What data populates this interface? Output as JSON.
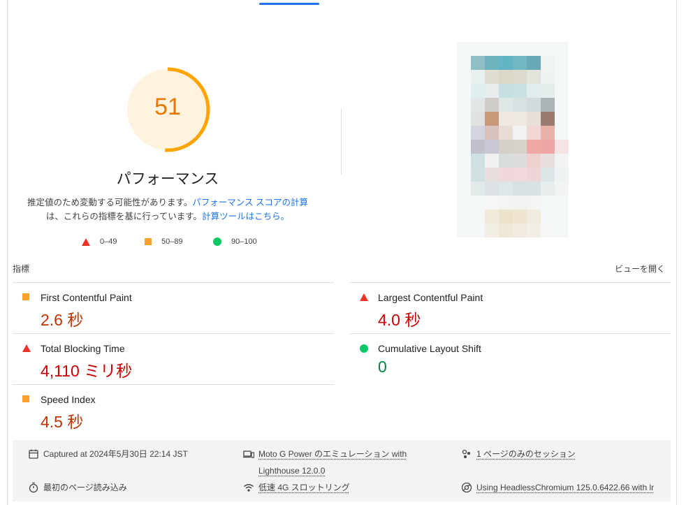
{
  "performance": {
    "score": "51",
    "score_fraction": 0.51,
    "title": "パフォーマンス",
    "description_part1": "推定値のため変動する可能性があります。",
    "description_link1": "パフォーマンス スコアの計算",
    "description_part2": "は、これらの指標を基に行っています。",
    "description_link2": "計算ツールはこちら。"
  },
  "legend": [
    {
      "label": "0–49",
      "shape": "triangle",
      "color": "#eb3327"
    },
    {
      "label": "50–89",
      "shape": "square",
      "color": "#faa22c"
    },
    {
      "label": "90–100",
      "shape": "circle",
      "color": "#0cc964"
    }
  ],
  "metrics_section": {
    "heading": "指標",
    "view_toggle": "ビューを開く"
  },
  "metrics": {
    "fcp": {
      "label": "First Contentful Paint",
      "value": "2.6 秒",
      "rating": "average"
    },
    "lcp": {
      "label": "Largest Contentful Paint",
      "value": "4.0 秒",
      "rating": "fail"
    },
    "tbt": {
      "label": "Total Blocking Time",
      "value": "4,110 ミリ秒",
      "rating": "fail"
    },
    "cls": {
      "label": "Cumulative Layout Shift",
      "value": "0",
      "rating": "pass"
    },
    "si": {
      "label": "Speed Index",
      "value": "4.5 秒",
      "rating": "average"
    }
  },
  "runtime": {
    "captured": "Captured at 2024年5月30日 22:14 JST",
    "device": "Moto G Power のエミュレーション with Lighthouse 12.0.0",
    "session": "1 ページのみのセッション",
    "load": "最初のページ読み込み",
    "throttling": "低速 4G スロットリング",
    "browser": "Using HeadlessChromium 125.0.6422.66 with lr"
  },
  "colors": {
    "gauge_arc": "#ffa400",
    "gauge_bg": "#fff3e0",
    "accent": "#1a73e8"
  }
}
